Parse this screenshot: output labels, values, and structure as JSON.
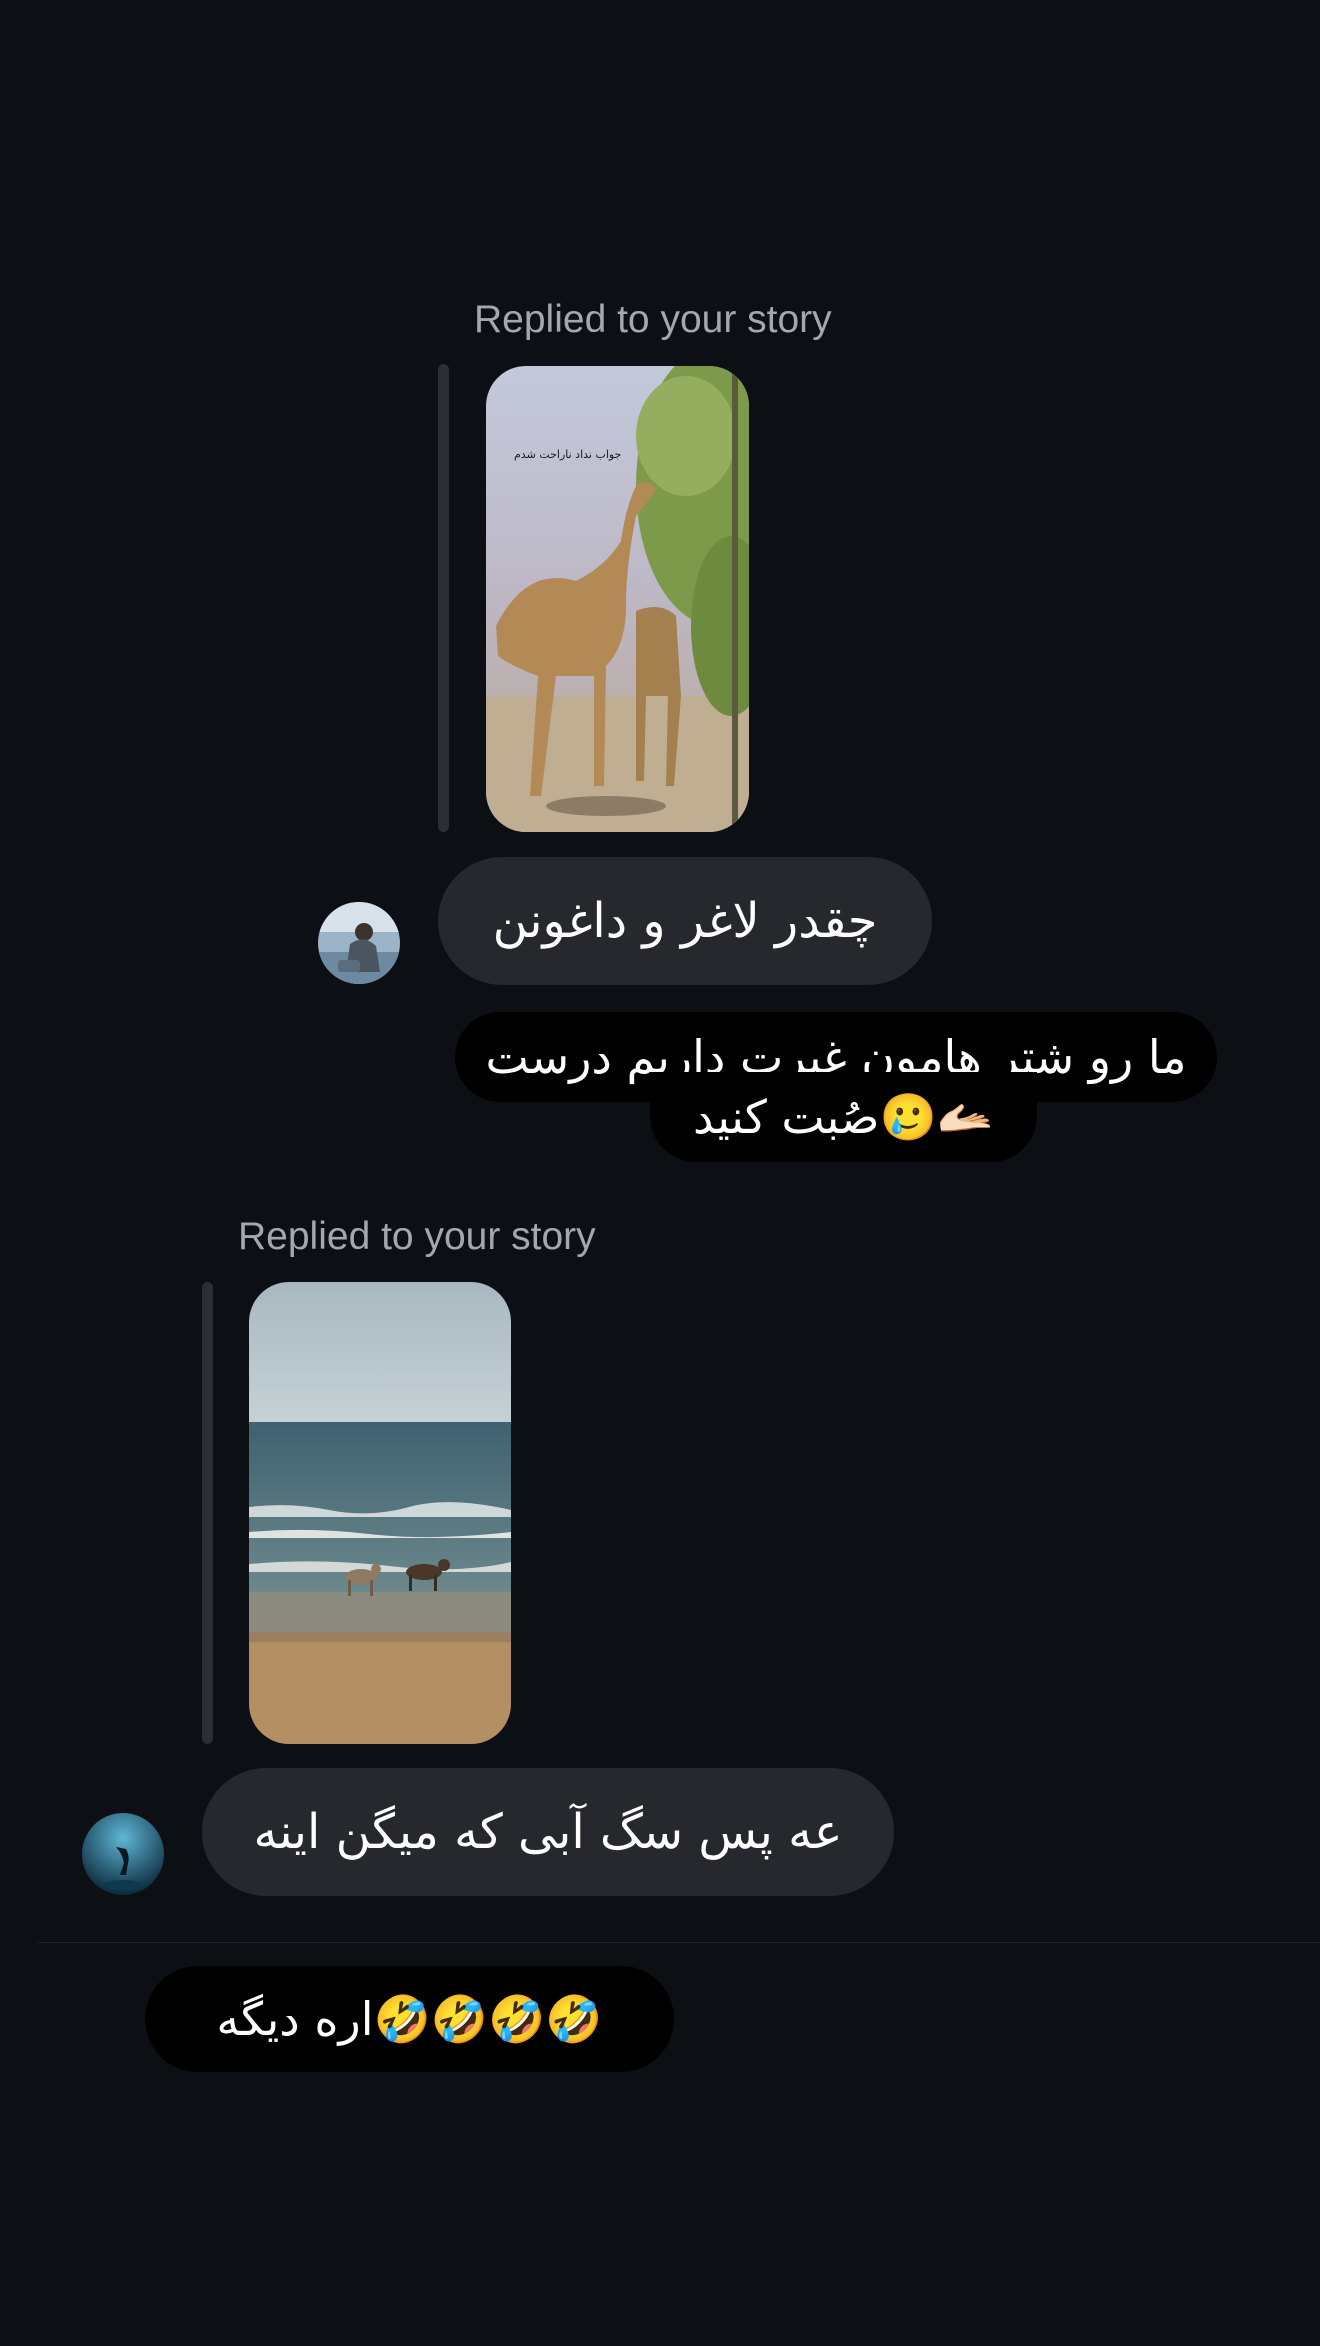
{
  "thread": {
    "story_reply_1": {
      "label": "Replied to your story",
      "story_caption": "جواب نداد ناراحت شدم"
    },
    "message_1": "چقدر لاغر و داغونن",
    "reply_1_line1": "ما رو شتر هامون غیرت داریم درست",
    "reply_1_line2": "صُبت کنید🥲🫴🏻",
    "story_reply_2": {
      "label": "Replied to your story"
    },
    "message_2": "عه پس سگ آبی که میگن اینه",
    "reply_2": "اره دیگه🤣🤣🤣🤣"
  },
  "colors": {
    "background": "#0c0f14",
    "incoming_bubble": "#26282d",
    "outgoing_bubble": "#000000",
    "label": "#a3a7ae"
  }
}
